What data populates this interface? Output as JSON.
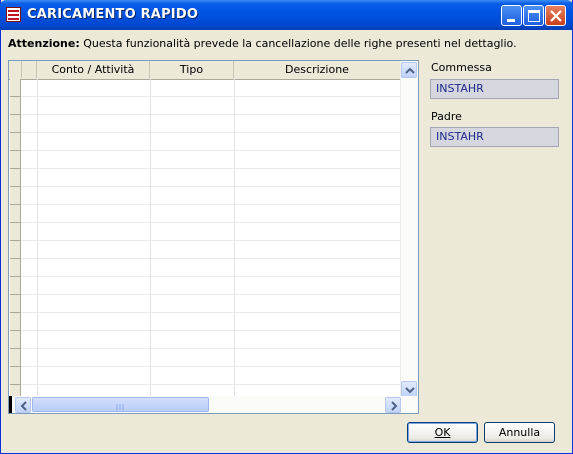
{
  "window": {
    "title": "CARICAMENTO RAPIDO",
    "accent": "#0054e3"
  },
  "notice": {
    "label": "Attenzione:",
    "text": " Questa funzionalità prevede la cancellazione delle righe presenti nel dettaglio."
  },
  "grid": {
    "columns": [
      "Conto / Attività",
      "Tipo",
      "Descrizione"
    ],
    "rows": []
  },
  "sidebar": {
    "commessa_label": "Commessa",
    "commessa_value": "INSTAHR",
    "padre_label": "Padre",
    "padre_value": "INSTAHR"
  },
  "buttons": {
    "ok_label": "OK",
    "annulla_label": "Annulla"
  },
  "icons": {
    "app": "app-list-icon",
    "minimize": "minimize-icon",
    "maximize": "maximize-icon",
    "close": "close-icon",
    "scroll_up": "chevron-up-icon",
    "scroll_down": "chevron-down-icon",
    "scroll_left": "chevron-left-icon",
    "scroll_right": "chevron-right-icon"
  }
}
